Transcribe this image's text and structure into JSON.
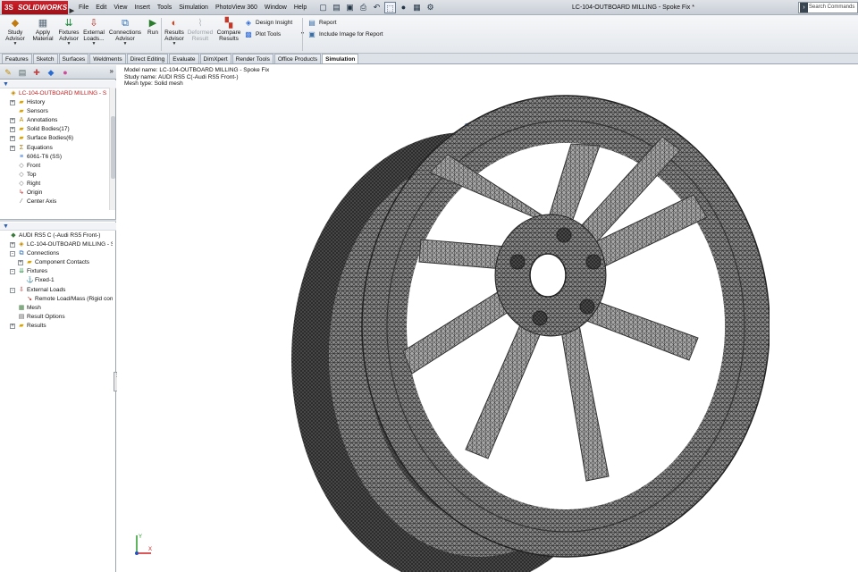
{
  "app": {
    "logo_text": "SOLIDWORKS",
    "document_title": "LC-104-OUTBOARD MILLING - Spoke Fix *",
    "search_placeholder": "Search Commands"
  },
  "menu": [
    "File",
    "Edit",
    "View",
    "Insert",
    "Tools",
    "Simulation",
    "PhotoView 360",
    "Window",
    "Help"
  ],
  "command_manager": {
    "big_buttons": [
      {
        "label": "Study\nAdvisor",
        "icon": "study-advisor-icon",
        "enabled": true
      },
      {
        "label": "Apply\nMaterial",
        "icon": "apply-material-icon",
        "enabled": true
      },
      {
        "label": "Fixtures\nAdvisor",
        "icon": "fixtures-advisor-icon",
        "enabled": true
      },
      {
        "label": "External\nLoads...",
        "icon": "external-loads-icon",
        "enabled": true
      },
      {
        "label": "Connections\nAdvisor",
        "icon": "connections-advisor-icon",
        "enabled": true
      },
      {
        "label": "Run",
        "icon": "run-icon",
        "enabled": true
      },
      {
        "label": "Results\nAdvisor",
        "icon": "results-advisor-icon",
        "enabled": true
      },
      {
        "label": "Deformed\nResult",
        "icon": "deformed-result-icon",
        "enabled": false
      },
      {
        "label": "Compare\nResults",
        "icon": "compare-results-icon",
        "enabled": true
      }
    ],
    "small_buttons": [
      {
        "label": "Design Insight",
        "icon": "design-insight-icon"
      },
      {
        "label": "Plot Tools",
        "icon": "plot-tools-icon"
      },
      {
        "label": "Report",
        "icon": "report-icon"
      },
      {
        "label": "Include Image for Report",
        "icon": "include-image-icon"
      }
    ]
  },
  "tabs": [
    {
      "label": "Features",
      "active": false
    },
    {
      "label": "Sketch",
      "active": false
    },
    {
      "label": "Surfaces",
      "active": false
    },
    {
      "label": "Weldments",
      "active": false
    },
    {
      "label": "Direct Editing",
      "active": false
    },
    {
      "label": "Evaluate",
      "active": false
    },
    {
      "label": "DimXpert",
      "active": false
    },
    {
      "label": "Render Tools",
      "active": false
    },
    {
      "label": "Office Products",
      "active": false
    },
    {
      "label": "Simulation",
      "active": true
    }
  ],
  "feature_tree": [
    {
      "label": "LC-104-OUTBOARD MILLING - S",
      "icon": "part-icon",
      "expander": "",
      "level": 0,
      "root": true
    },
    {
      "label": "History",
      "icon": "history-folder-icon",
      "expander": "+",
      "level": 1
    },
    {
      "label": "Sensors",
      "icon": "sensors-folder-icon",
      "expander": "",
      "level": 1
    },
    {
      "label": "Annotations",
      "icon": "annotations-icon",
      "expander": "+",
      "level": 1
    },
    {
      "label": "Solid Bodies(17)",
      "icon": "solid-bodies-icon",
      "expander": "+",
      "level": 1
    },
    {
      "label": "Surface Bodies(6)",
      "icon": "surface-bodies-icon",
      "expander": "+",
      "level": 1
    },
    {
      "label": "Equations",
      "icon": "equations-icon",
      "expander": "+",
      "level": 1
    },
    {
      "label": "6061-T6 (SS)",
      "icon": "material-icon",
      "expander": "",
      "level": 1
    },
    {
      "label": "Front",
      "icon": "plane-icon",
      "expander": "",
      "level": 1
    },
    {
      "label": "Top",
      "icon": "plane-icon",
      "expander": "",
      "level": 1
    },
    {
      "label": "Right",
      "icon": "plane-icon",
      "expander": "",
      "level": 1
    },
    {
      "label": "Origin",
      "icon": "origin-icon",
      "expander": "",
      "level": 1
    },
    {
      "label": "Center Axis",
      "icon": "axis-icon",
      "expander": "",
      "level": 1
    }
  ],
  "study_tree": [
    {
      "label": "AUDI RS5 C (-Audi RS5 Front-)",
      "icon": "study-icon",
      "expander": "",
      "level": 0
    },
    {
      "label": "LC-104-OUTBOARD MILLING - Spok",
      "icon": "part-warning-icon",
      "expander": "+",
      "level": 1
    },
    {
      "label": "Connections",
      "icon": "connections-icon",
      "expander": "-",
      "level": 1
    },
    {
      "label": "Component Contacts",
      "icon": "contacts-folder-icon",
      "expander": "+",
      "level": 2
    },
    {
      "label": "Fixtures",
      "icon": "fixtures-icon",
      "expander": "-",
      "level": 1
    },
    {
      "label": "Fixed-1",
      "icon": "fixed-icon",
      "expander": "",
      "level": 2
    },
    {
      "label": "External Loads",
      "icon": "external-loads-folder-icon",
      "expander": "-",
      "level": 1
    },
    {
      "label": "Remote Load/Mass (Rigid conne",
      "icon": "remote-load-icon",
      "expander": "",
      "level": 2
    },
    {
      "label": "Mesh",
      "icon": "mesh-icon",
      "expander": "",
      "level": 1
    },
    {
      "label": "Result Options",
      "icon": "result-options-icon",
      "expander": "",
      "level": 1
    },
    {
      "label": "Results",
      "icon": "results-folder-icon",
      "expander": "+",
      "level": 1
    }
  ],
  "graphics": {
    "info_lines": [
      "Model name: LC-104-OUTBOARD MILLING - Spoke Fix",
      "Study name: AUDI RS5 C(-Audi RS5 Front-)",
      "Mesh type: Solid mesh"
    ],
    "triad_labels": {
      "y": "Y",
      "x": "X"
    }
  }
}
